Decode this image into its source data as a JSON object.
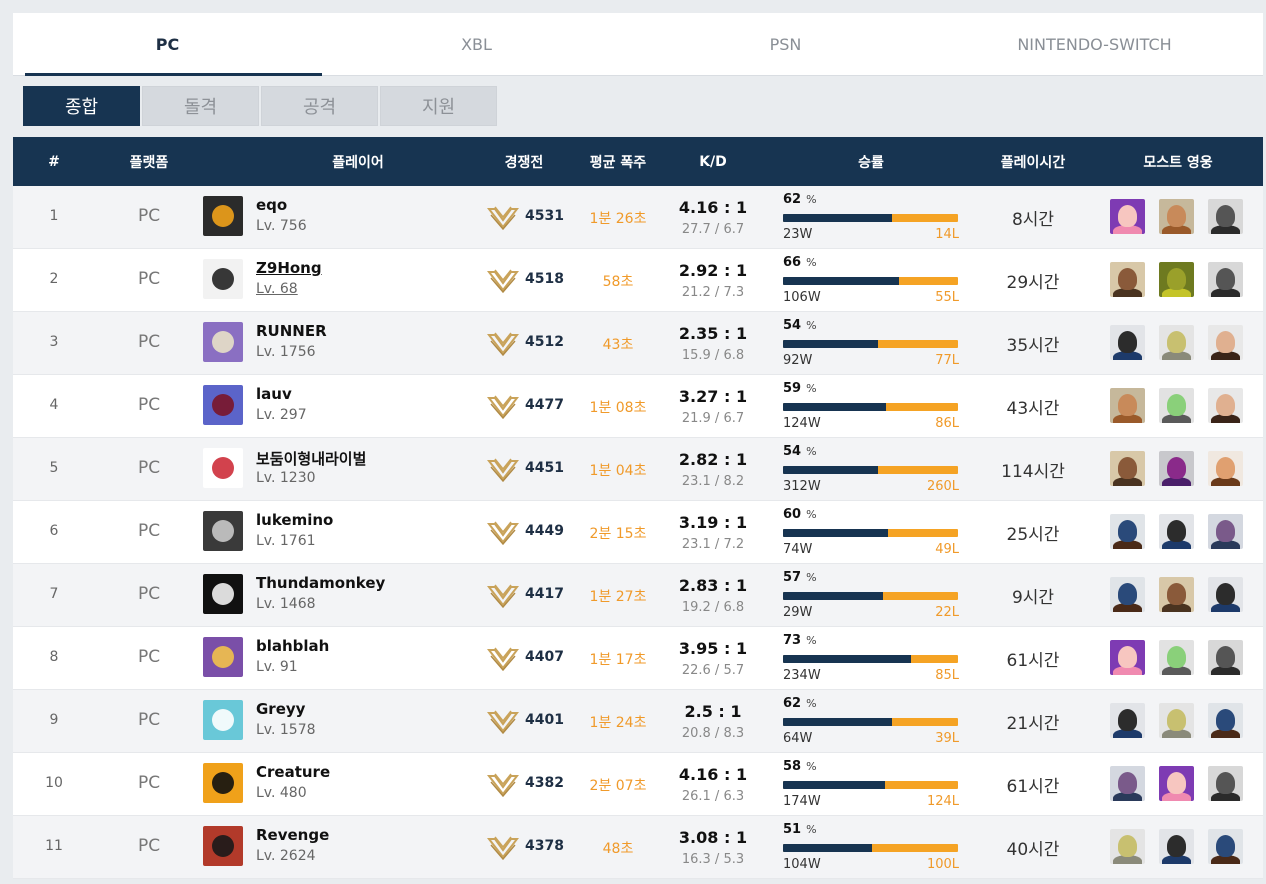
{
  "platform_tabs": [
    "PC",
    "XBL",
    "PSN",
    "NINTENDO-SWITCH"
  ],
  "role_tabs": [
    "종합",
    "돌격",
    "공격",
    "지원"
  ],
  "columns": {
    "rank": "#",
    "platform": "플랫폼",
    "player": "플레이어",
    "competitive": "경쟁전",
    "avg_streak": "평균 폭주",
    "kd": "K/D",
    "winrate": "승률",
    "playtime": "플레이시간",
    "most_heroes": "모스트 영웅"
  },
  "win_suffix": "%",
  "rows": [
    {
      "rank": "1",
      "platform": "PC",
      "name": "eqo",
      "level": "Lv. 756",
      "sr": "4531",
      "streak": "1분 26초",
      "kd": "4.16 : 1",
      "kd_detail": "27.7 / 6.7",
      "win_pct": "62",
      "win_fraction": 0.62,
      "wins": "23W",
      "losses": "14L",
      "playtime": "8시간",
      "avatar_icon": "fire-emblem-icon",
      "heroes": [
        "zarya-icon",
        "brigitte-icon",
        "reaper-icon"
      ]
    },
    {
      "rank": "2",
      "platform": "PC",
      "name": "Z9Hong",
      "level": "Lv. 68",
      "sr": "4518",
      "streak": "58초",
      "kd": "2.92 : 1",
      "kd_detail": "21.2 / 7.3",
      "win_pct": "66",
      "win_fraction": 0.66,
      "wins": "106W",
      "losses": "55L",
      "playtime": "29시간",
      "avatar_icon": "archer-icon",
      "heroes": [
        "mccree-icon",
        "orisa-icon",
        "reaper-icon"
      ]
    },
    {
      "rank": "3",
      "platform": "PC",
      "name": "RUNNER",
      "level": "Lv. 1756",
      "sr": "4512",
      "streak": "43초",
      "kd": "2.35 : 1",
      "kd_detail": "15.9 / 6.8",
      "win_pct": "54",
      "win_fraction": 0.54,
      "wins": "92W",
      "losses": "77L",
      "playtime": "35시간",
      "avatar_icon": "mask-icon",
      "heroes": [
        "ana-icon",
        "zenyatta-icon",
        "mei-icon"
      ]
    },
    {
      "rank": "4",
      "platform": "PC",
      "name": "lauv",
      "level": "Lv. 297",
      "sr": "4477",
      "streak": "1분 08초",
      "kd": "3.27 : 1",
      "kd_detail": "21.9 / 6.7",
      "win_pct": "59",
      "win_fraction": 0.59,
      "wins": "124W",
      "losses": "86L",
      "playtime": "43시간",
      "avatar_icon": "fleur-de-lis-icon",
      "heroes": [
        "brigitte-icon",
        "genji-icon",
        "mei-icon"
      ]
    },
    {
      "rank": "5",
      "platform": "PC",
      "name": "보둠이형내라이벌",
      "level": "Lv. 1230",
      "sr": "4451",
      "streak": "1분 04초",
      "kd": "2.82 : 1",
      "kd_detail": "23.1 / 8.2",
      "win_pct": "54",
      "win_fraction": 0.54,
      "wins": "312W",
      "losses": "260L",
      "playtime": "114시간",
      "avatar_icon": "korea-flag-icon",
      "heroes": [
        "mccree-icon",
        "widowmaker-icon",
        "tracer-icon"
      ]
    },
    {
      "rank": "6",
      "platform": "PC",
      "name": "lukemino",
      "level": "Lv. 1761",
      "sr": "4449",
      "streak": "2분 15초",
      "kd": "3.19 : 1",
      "kd_detail": "23.1 / 7.2",
      "win_pct": "60",
      "win_fraction": 0.6,
      "wins": "74W",
      "losses": "49L",
      "playtime": "25시간",
      "avatar_icon": "robot-head-icon",
      "heroes": [
        "baptiste-icon",
        "ana-icon",
        "sombra-icon"
      ]
    },
    {
      "rank": "7",
      "platform": "PC",
      "name": "Thundamonkey",
      "level": "Lv. 1468",
      "sr": "4417",
      "streak": "1분 27초",
      "kd": "2.83 : 1",
      "kd_detail": "19.2 / 6.8",
      "win_pct": "57",
      "win_fraction": 0.57,
      "wins": "29W",
      "losses": "22L",
      "playtime": "9시간",
      "avatar_icon": "sf-logo-icon",
      "heroes": [
        "baptiste-icon",
        "mccree-icon",
        "ana-icon"
      ]
    },
    {
      "rank": "8",
      "platform": "PC",
      "name": "blahblah",
      "level": "Lv. 91",
      "sr": "4407",
      "streak": "1분 17초",
      "kd": "3.95 : 1",
      "kd_detail": "22.6 / 5.7",
      "win_pct": "73",
      "win_fraction": 0.73,
      "wins": "234W",
      "losses": "85L",
      "playtime": "61시간",
      "avatar_icon": "crowned-face-icon",
      "heroes": [
        "zarya-icon",
        "genji-icon",
        "reaper-icon"
      ]
    },
    {
      "rank": "9",
      "platform": "PC",
      "name": "Greyy",
      "level": "Lv. 1578",
      "sr": "4401",
      "streak": "1분 24초",
      "kd": "2.5 : 1",
      "kd_detail": "20.8 / 8.3",
      "win_pct": "62",
      "win_fraction": 0.62,
      "wins": "64W",
      "losses": "39L",
      "playtime": "21시간",
      "avatar_icon": "snowman-icon",
      "heroes": [
        "ana-icon",
        "zenyatta-icon",
        "baptiste-icon"
      ]
    },
    {
      "rank": "10",
      "platform": "PC",
      "name": "Creature",
      "level": "Lv. 480",
      "sr": "4382",
      "streak": "2분 07초",
      "kd": "4.16 : 1",
      "kd_detail": "26.1 / 6.3",
      "win_pct": "58",
      "win_fraction": 0.58,
      "wins": "174W",
      "losses": "124L",
      "playtime": "61시간",
      "avatar_icon": "black-cat-icon",
      "heroes": [
        "sombra-icon",
        "zarya-icon",
        "reaper-icon"
      ]
    },
    {
      "rank": "11",
      "platform": "PC",
      "name": "Revenge",
      "level": "Lv. 2624",
      "sr": "4378",
      "streak": "48초",
      "kd": "3.08 : 1",
      "kd_detail": "16.3 / 5.3",
      "win_pct": "51",
      "win_fraction": 0.51,
      "wins": "104W",
      "losses": "100L",
      "playtime": "40시간",
      "avatar_icon": "samurai-icon",
      "heroes": [
        "zenyatta-icon",
        "ana-icon",
        "baptiste-icon"
      ]
    }
  ],
  "colors": {
    "navy": "#173451",
    "orange": "#f5a324",
    "gold": "#c9a35a"
  }
}
